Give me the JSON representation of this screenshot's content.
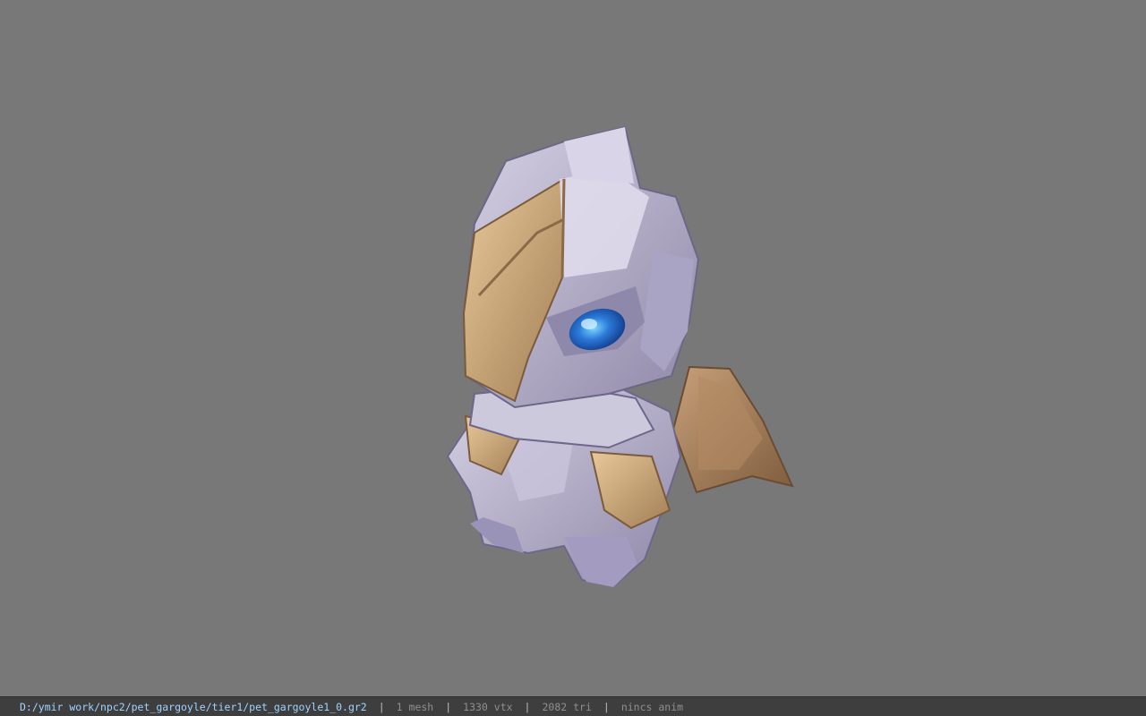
{
  "status_bar": {
    "file_path": "D:/ymir work/npc2/pet_gargoyle/tier1/pet_gargoyle1_0.gr2",
    "separator": "|",
    "mesh_count": "1 mesh",
    "vertex_count": "1330 vtx",
    "triangle_count": "2082 tri",
    "animation": "nincs anim"
  },
  "viewport": {
    "background_color": "#787878",
    "model": "pet-gargoyle"
  },
  "colors": {
    "status_path": "#9fd3ff",
    "status_text": "#8f8f8f",
    "status_bg": "#3e3e3e"
  }
}
